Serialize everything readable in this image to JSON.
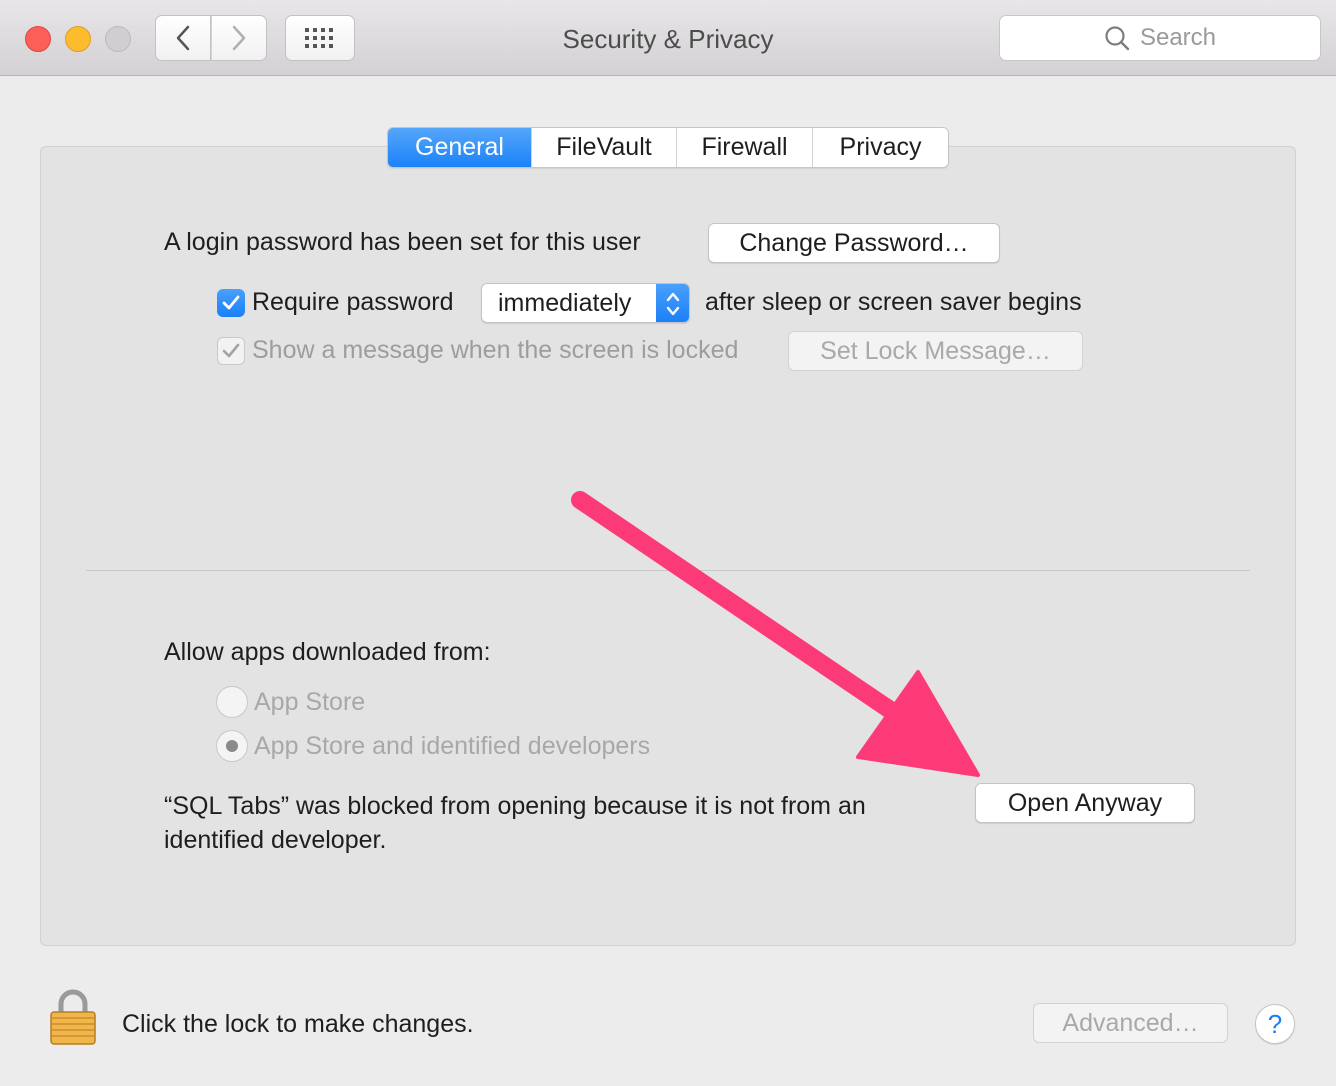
{
  "window": {
    "title": "Security & Privacy",
    "search_placeholder": "Search"
  },
  "tabs": [
    {
      "label": "General",
      "active": true
    },
    {
      "label": "FileVault",
      "active": false
    },
    {
      "label": "Firewall",
      "active": false
    },
    {
      "label": "Privacy",
      "active": false
    }
  ],
  "general": {
    "login_text": "A login password has been set for this user",
    "change_password_label": "Change Password…",
    "require_password": {
      "checked": true,
      "label": "Require password",
      "selected_option": "immediately",
      "suffix": "after sleep or screen saver begins"
    },
    "show_message": {
      "checked": true,
      "enabled": false,
      "label": "Show a message when the screen is locked",
      "button_label": "Set Lock Message…"
    }
  },
  "allow_apps": {
    "heading": "Allow apps downloaded from:",
    "options": [
      {
        "label": "App Store",
        "selected": false
      },
      {
        "label": "App Store and identified developers",
        "selected": true
      }
    ],
    "blocked_line1": "“SQL Tabs” was blocked from opening because it is not from an",
    "blocked_line2": "identified developer.",
    "open_anyway_label": "Open Anyway"
  },
  "footer": {
    "lock_text": "Click the lock to make changes.",
    "advanced_label": "Advanced…",
    "help_label": "?"
  },
  "colors": {
    "accent_blue": "#1a82f8",
    "annotation_arrow": "#fd3a78",
    "lock_gold": "#f0b64a"
  }
}
